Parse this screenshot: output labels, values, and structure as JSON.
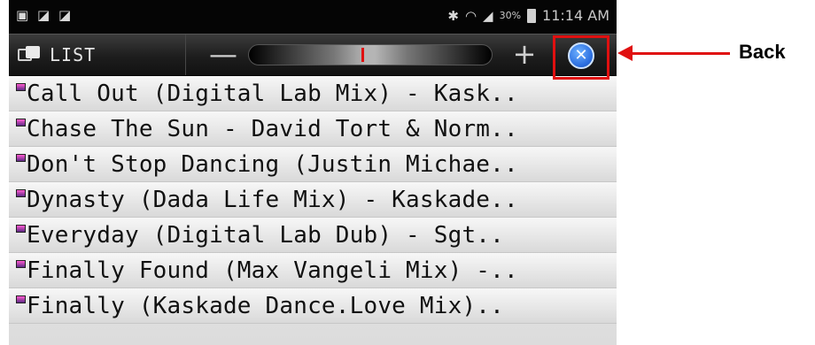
{
  "status_bar": {
    "left_icons": [
      "notification-icon",
      "bag-icon",
      "bag-icon"
    ],
    "battery_percent": "30%",
    "time": "11:14 AM"
  },
  "toolbar": {
    "list_label": "LIST",
    "minus_label": "—",
    "plus_label": "+",
    "volume_level": 0.47
  },
  "tracks": [
    "Call Out (Digital Lab Mix) - Kask..",
    "Chase The Sun - David Tort & Norm..",
    "Don't Stop Dancing (Justin Michae..",
    "Dynasty (Dada Life Mix) - Kaskade..",
    "Everyday (Digital Lab Dub) - Sgt..",
    "Finally Found (Max Vangeli Mix) -..",
    "Finally (Kaskade Dance.Love Mix).."
  ],
  "annotation": {
    "label": "Back",
    "color": "#e01010"
  }
}
